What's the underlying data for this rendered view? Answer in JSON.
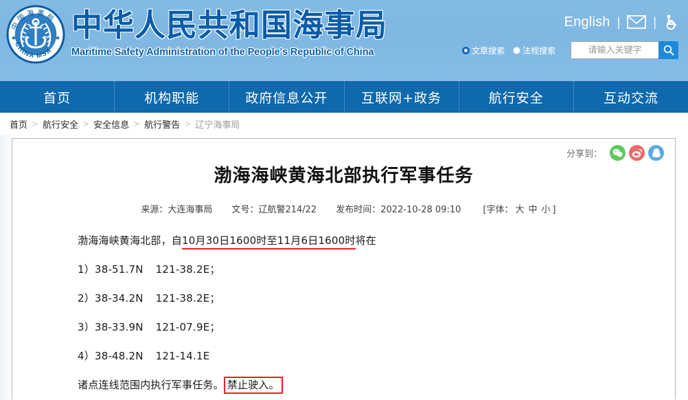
{
  "header": {
    "logo_alt": "china-msa-seal",
    "brand_cn": "中华人民共和国海事局",
    "brand_en": "Maritime Safety Administration of the People's Republic of China",
    "english_link": "English",
    "separator": "|",
    "mail_icon": "mail-icon",
    "accessibility_icon": "accessibility-icon"
  },
  "search": {
    "radios": [
      {
        "label": "文章搜索",
        "selected": true
      },
      {
        "label": "法规搜索",
        "selected": false
      }
    ],
    "placeholder": "请输入关键字",
    "value": "",
    "button_icon": "search-icon"
  },
  "nav": {
    "items": [
      {
        "label": "首页"
      },
      {
        "label": "机构职能"
      },
      {
        "label": "政府信息公开"
      },
      {
        "label": "互联网+政务"
      },
      {
        "label": "航行安全"
      },
      {
        "label": "互动交流"
      }
    ]
  },
  "breadcrumb": {
    "separator": ">",
    "items": [
      {
        "label": "首页"
      },
      {
        "label": "航行安全"
      },
      {
        "label": "安全信息"
      },
      {
        "label": "航行警告"
      },
      {
        "label": "辽宁海事局"
      }
    ]
  },
  "share": {
    "label": "分享到：",
    "targets": [
      {
        "name": "wechat",
        "color": "#5cc95c"
      },
      {
        "name": "weibo",
        "color": "#ec6a6a"
      },
      {
        "name": "qq",
        "color": "#5aaae8"
      }
    ]
  },
  "article": {
    "title": "渤海海峡黄海北部执行军事任务",
    "meta": {
      "source_label": "来源：",
      "source_value": "大连海事局",
      "docno_label": "文号：",
      "docno_value": "辽航警214/22",
      "publish_label": "发布时间：",
      "publish_value": "2022-10-28 09:10",
      "font_prefix": "[字体：",
      "font_large": "大",
      "font_medium": "中",
      "font_small": "小",
      "font_suffix": "]"
    },
    "paragraphs": {
      "intro_before": "渤海海峡黄海北部，自",
      "intro_highlight": "10月30日1600时至11月6日1600时",
      "intro_after": "将在",
      "points": [
        {
          "index": "1）",
          "lat": "38-51.7N",
          "lon": "121-38.2E",
          "tail": "；"
        },
        {
          "index": "2）",
          "lat": "38-34.2N",
          "lon": "121-38.2E",
          "tail": "；"
        },
        {
          "index": "3）",
          "lat": "38-33.9N",
          "lon": "121-07.9E",
          "tail": "；"
        },
        {
          "index": "4）",
          "lat": "38-48.2N",
          "lon": "121-14.1E",
          "tail": ""
        }
      ],
      "closing_before": "诸点连线范围内执行军事任务。",
      "closing_boxed": "禁止驶入。"
    }
  },
  "colors": {
    "header_blue": "#7fb7e2",
    "nav_blue": "#0f69ac",
    "brand_blue": "#0a5ca8",
    "accent_red": "#ee1c25",
    "search_btn": "#2089d6"
  }
}
